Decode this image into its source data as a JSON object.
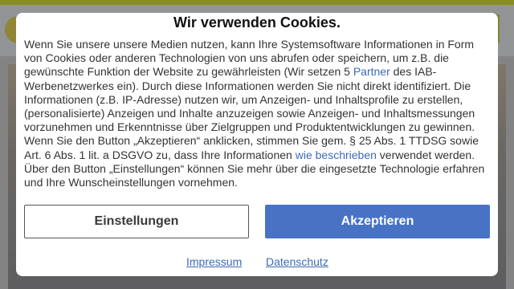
{
  "dialog": {
    "title": "Wir verwenden Cookies.",
    "body_part1": "Wenn Sie unsere unsere Medien nutzen, kann Ihre Systemsoftware Informationen in Form von Cookies oder anderen Technologien von uns abrufen oder speichern, um z.B. die gewünschte Funktion der Website zu gewährleisten (Wir setzen 5 ",
    "link_partner": "Partner",
    "body_part2": " des IAB-Werbenetzwerkes ein). Durch diese Informationen werden Sie nicht direkt identifiziert. Die Informationen (z.B. IP-Adresse) nutzen wir, um Anzeigen- und Inhaltsprofile zu erstellen, (personalisierte) Anzeigen und Inhalte anzuzeigen sowie Anzeigen- und Inhaltsmessungen vorzunehmen und Erkenntnisse über Zielgruppen und Produktentwicklungen zu gewinnen. Wenn Sie den Button „Akzeptieren“ anklicken, stimmen Sie gem. § 25 Abs. 1 TTDSG sowie Art. 6 Abs. 1 lit. a DSGVO zu, dass Ihre Informationen ",
    "link_described": "wie beschrieben",
    "body_part3": " verwendet werden. Über den Button „Einstellungen“ können Sie mehr über die eingesetzte Technologie erfahren und Ihre Wunscheinstellungen vornehmen.",
    "settings_label": "Einstellungen",
    "accept_label": "Akzeptieren",
    "impressum_label": "Impressum",
    "datenschutz_label": "Datenschutz"
  },
  "colors": {
    "accent": "#4873c5",
    "link": "#3d6ab5",
    "header_accent": "#c8d400"
  }
}
